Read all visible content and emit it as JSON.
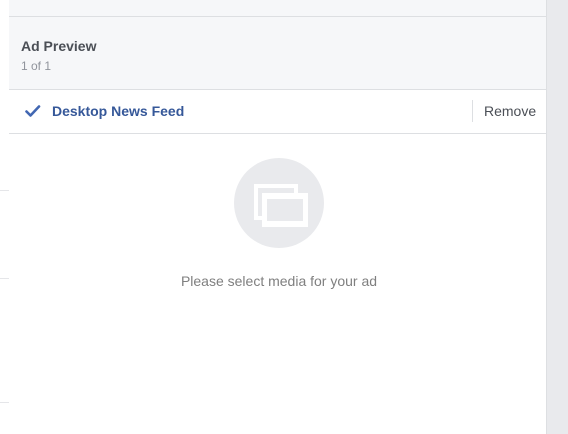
{
  "ad_preview": {
    "title": "Ad Preview",
    "page_count": "1 of 1"
  },
  "placement": {
    "label": "Desktop News Feed",
    "selected": true,
    "remove_label": "Remove"
  },
  "media": {
    "placeholder_icon": "media-placeholder-icon",
    "empty_message": "Please select media for your ad"
  },
  "colors": {
    "link_blue": "#365899",
    "check_blue": "#4267b2",
    "header_bg": "#f6f7f9",
    "border": "#dddfe2"
  }
}
